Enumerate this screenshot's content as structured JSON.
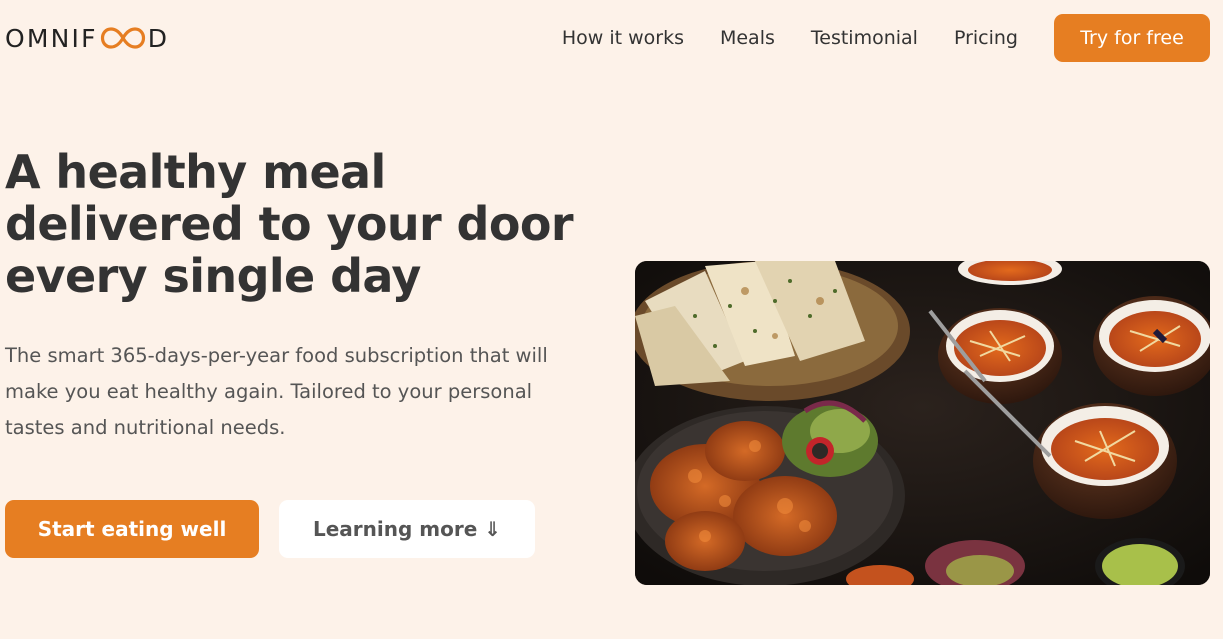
{
  "header": {
    "logo_left": "OMNIF",
    "logo_right": "D",
    "logo_full": "OMNIFOOD",
    "nav": [
      {
        "label": "How it works"
      },
      {
        "label": "Meals"
      },
      {
        "label": "Testimonial"
      },
      {
        "label": "Pricing"
      }
    ],
    "cta_label": "Try for free"
  },
  "hero": {
    "title": "A healthy meal delivered to your door every single day",
    "description": "The smart 365-days-per-year food subscription that will make you eat healthy again. Tailored to your personal tastes and nutritional needs.",
    "primary_button": "Start eating well",
    "secondary_button": "Learning more ⇓"
  },
  "colors": {
    "accent": "#e67e22",
    "background": "#fdf2e9",
    "text": "#333333"
  },
  "icons": {
    "logo_mark": "infinity-icon"
  }
}
